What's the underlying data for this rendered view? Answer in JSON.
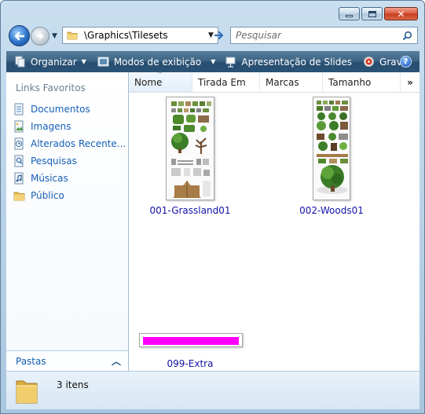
{
  "window": {
    "caption_buttons": {
      "minimize": "minimize",
      "maximize": "maximize",
      "close": "✕"
    }
  },
  "address_bar": {
    "path": "\\Graphics\\Tilesets",
    "back_icon": "back-arrow-icon",
    "forward_icon": "forward-arrow-icon",
    "go_icon": "go-arrow-icon"
  },
  "search": {
    "placeholder": "Pesquisar",
    "icon": "magnifier-icon"
  },
  "toolbar": {
    "organize": "Organizar",
    "views": "Modos de exibição",
    "slideshow": "Apresentação de Slides",
    "burn": "Gravar",
    "help": "?"
  },
  "nav_pane": {
    "heading": "Links Favoritos",
    "links": [
      {
        "label": "Documentos",
        "icon": "documents-icon"
      },
      {
        "label": "Imagens",
        "icon": "pictures-icon"
      },
      {
        "label": "Alterados Recente...",
        "icon": "recently-changed-icon"
      },
      {
        "label": "Pesquisas",
        "icon": "searches-icon"
      },
      {
        "label": "Músicas",
        "icon": "music-icon"
      },
      {
        "label": "Público",
        "icon": "public-folder-icon"
      }
    ],
    "folders_label": "Pastas"
  },
  "columns": [
    {
      "label": "Nome",
      "sorted": true
    },
    {
      "label": "Tirada Em",
      "sorted": false
    },
    {
      "label": "Marcas",
      "sorted": false
    },
    {
      "label": "Tamanho",
      "sorted": false
    }
  ],
  "columns_more": "»",
  "files": [
    {
      "name": "001-Grassland01"
    },
    {
      "name": "002-Woods01"
    },
    {
      "name": "099-Extra"
    }
  ],
  "status": {
    "count_text": "3 itens"
  },
  "colors": {
    "link": "#1560b6",
    "file_label": "#1212a8",
    "extra_thumb": "#ff00ff",
    "toolbar": "#3d6485"
  }
}
